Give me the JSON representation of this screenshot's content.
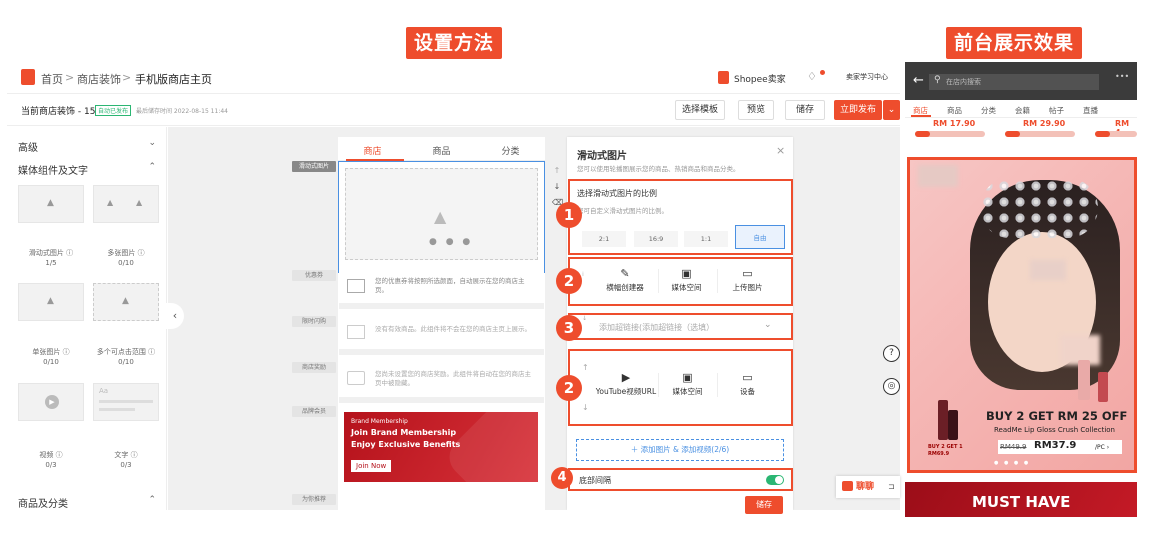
{
  "labels": {
    "setup": "设置方法",
    "preview": "前台展示效果"
  },
  "breadcrumb": {
    "home": "首页",
    "sep1": ">",
    "decor": "商店装饰",
    "sep2": ">",
    "current": "手机版商店主页"
  },
  "topright": {
    "seller": "Shopee卖家",
    "learn": "卖家学习中心"
  },
  "status": {
    "title": "当前商店装饰 - 15",
    "badge": "自动已发布",
    "saved": "最后储存时间 2022-08-15 11:44"
  },
  "buttons": {
    "template": "选择模板",
    "preview": "预览",
    "save": "储存",
    "publish": "立即发布"
  },
  "leftpanel": {
    "advanced": "高级",
    "media": "媒体组件及文字",
    "tiles": [
      {
        "name": "滑动式图片 ⓘ",
        "count": "1/5"
      },
      {
        "name": "多张图片 ⓘ",
        "count": "0/10"
      },
      {
        "name": "单张图片 ⓘ",
        "count": "0/10"
      },
      {
        "name": "多个可点击范围 ⓘ",
        "count": "0/10"
      },
      {
        "name": "视频 ⓘ",
        "count": "0/3"
      },
      {
        "name": "文字 ⓘ",
        "count": "0/3"
      }
    ],
    "products": "商品及分类"
  },
  "phone": {
    "tabs": [
      "商店",
      "商品",
      "分类"
    ],
    "side_labels": [
      "滑动式图片",
      "优惠券",
      "限时闪购",
      "商店奖励",
      "品牌会员",
      "为你推荐"
    ],
    "coupon_text": "您的优惠券将按照所选颜面，自动展示在您的商店主页。",
    "flash_text": "没有有效商品。此组件将不会在您的商店主页上展示。",
    "reward_text": "您尚未设置您的商店奖励。此组件将自动在您的商店主页中被隐藏。",
    "membership": {
      "small": "Brand Membership",
      "line1": "Join Brand Membership",
      "line2": "Enjoy Exclusive Benefits",
      "btn": "Join Now"
    }
  },
  "settings": {
    "title": "滑动式图片",
    "desc": "您可以使用轮播图展示您的商品、热销商品和商品分类。",
    "ratio_title": "选择滑动式图片的比例",
    "ratio_desc": "您可自定义滑动式图片的比例。",
    "ratios": [
      "2:1",
      "16:9",
      "1:1",
      "自由"
    ],
    "opts1": [
      "横幅创建器",
      "媒体空间",
      "上传图片"
    ],
    "link_placeholder": "添加超链接(添加超链接（选填）",
    "opts2": [
      "YouTube视频URL",
      "媒体空间",
      "设备"
    ],
    "add_btn": "＋ 添加图片 & 添加视频(2/6)",
    "bottom_gap": "底部间隔",
    "save": "储存",
    "steps": [
      "1",
      "2",
      "3",
      "2",
      "4"
    ]
  },
  "chat": {
    "label": "聊聊"
  },
  "preview": {
    "search": "在店内搜索",
    "tabs": [
      "商店",
      "商品",
      "分类",
      "会籍",
      "帖子",
      "直播"
    ],
    "prices": [
      "RM 17.90",
      "RM 29.90",
      "RM 4"
    ],
    "promo": {
      "headline": "BUY 2 GET RM 25 OFF",
      "sub": "ReadMe Lip Gloss Crush Collection",
      "old_price": "RM49.9",
      "new_price": "RM37.9",
      "suffix": "/PC ›"
    },
    "mini": {
      "line1": "BUY 2 GET 1",
      "line2": "RM69.9"
    },
    "must_have": "MUST HAVE"
  },
  "colors": {
    "accent": "#ee4d2d",
    "toggle": "#2bb673"
  }
}
